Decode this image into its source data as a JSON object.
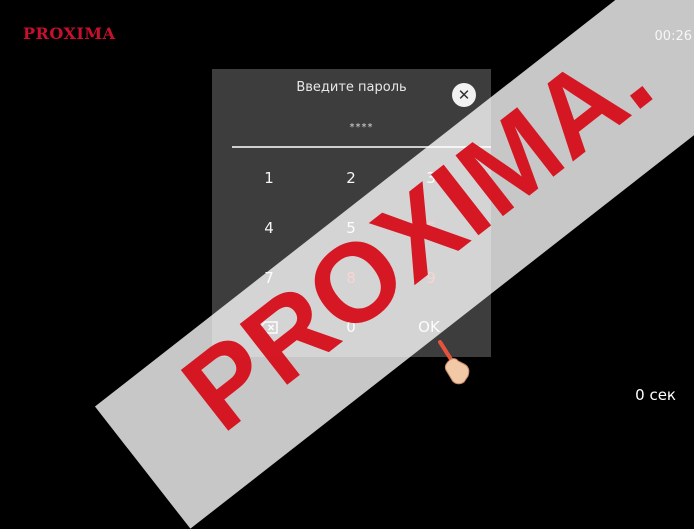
{
  "header": {
    "brand": "PROXIMA",
    "clock": "00:26"
  },
  "dialog": {
    "title": "Введите пароль",
    "password_mask": "****",
    "keys": [
      "1",
      "2",
      "3",
      "4",
      "5",
      "6",
      "7",
      "8",
      "9",
      "0",
      "OK"
    ]
  },
  "footer": {
    "timer": "0 сек"
  },
  "watermark": {
    "text": "PROXIMA."
  },
  "colors": {
    "accent_red": "#e0413c",
    "brand_red": "#c8102e",
    "dialog_bg": "#3d3d3d"
  },
  "icons": {
    "close": "close-icon",
    "backspace": "backspace-icon",
    "pointer": "hand-pointer-icon"
  }
}
